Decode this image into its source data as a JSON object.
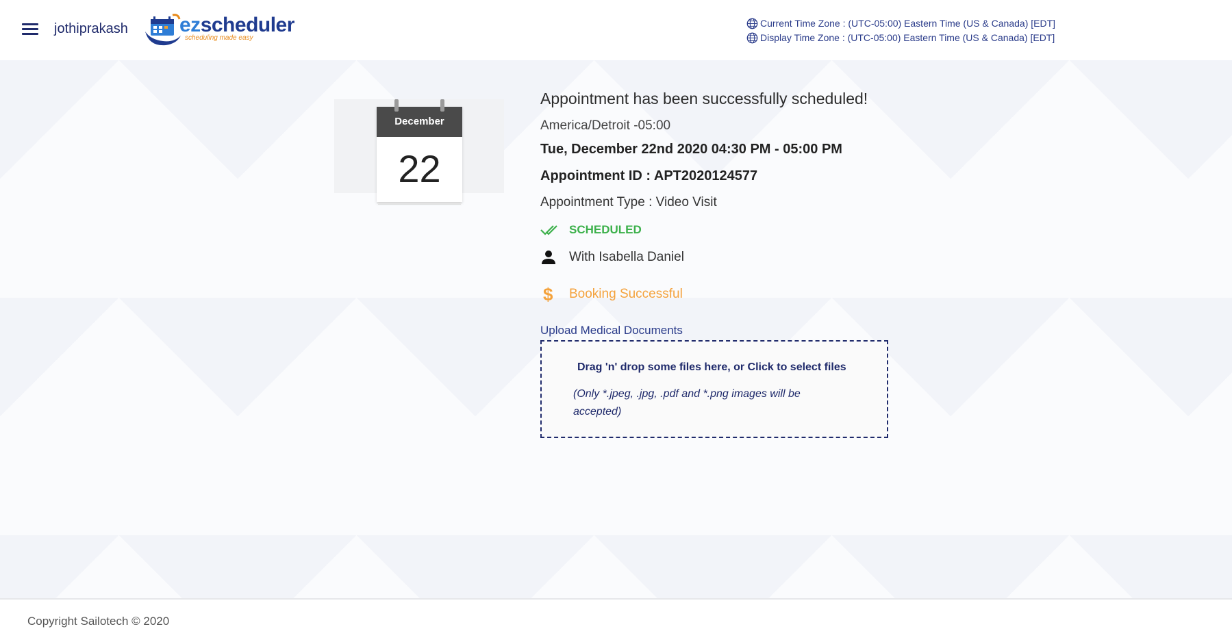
{
  "header": {
    "menu_icon": "hamburger-menu-icon",
    "username": "jothiprakash",
    "logo": {
      "brand_prefix": "ez",
      "brand_suffix": "scheduler",
      "tagline": "scheduling made easy"
    },
    "current_time_zone": "Current Time Zone : (UTC-05:00) Eastern Time (US & Canada) [EDT]",
    "display_time_zone": "Display Time Zone : (UTC-05:00) Eastern Time (US & Canada) [EDT]",
    "globe_icon": "globe-icon"
  },
  "calendar": {
    "month": "December",
    "day": "22"
  },
  "appointment": {
    "title": "Appointment has been successfully scheduled!",
    "timezone": "America/Detroit -05:00",
    "datetime": "Tue, December 22nd 2020 04:30 PM - 05:00 PM",
    "id_line": "Appointment ID : APT2020124577",
    "type_line": "Appointment Type : Video Visit",
    "status": "SCHEDULED",
    "status_icon": "double-check-icon",
    "provider": "With Isabella Daniel",
    "provider_icon": "person-icon",
    "payment_status": "Booking Successful",
    "payment_icon": "dollar-icon"
  },
  "upload": {
    "label": "Upload Medical Documents",
    "dropzone_text": "Drag 'n' drop some files here, or Click to select files",
    "note": "(Only *.jpeg, .jpg, .pdf and *.png images will be accepted)"
  },
  "footer": {
    "copyright": "Copyright Sailotech © 2020"
  },
  "colors": {
    "navy": "#1f2a6b",
    "success_green": "#3bb04a",
    "payment_orange": "#f4a23c",
    "calendar_header": "#4a4a4a"
  }
}
